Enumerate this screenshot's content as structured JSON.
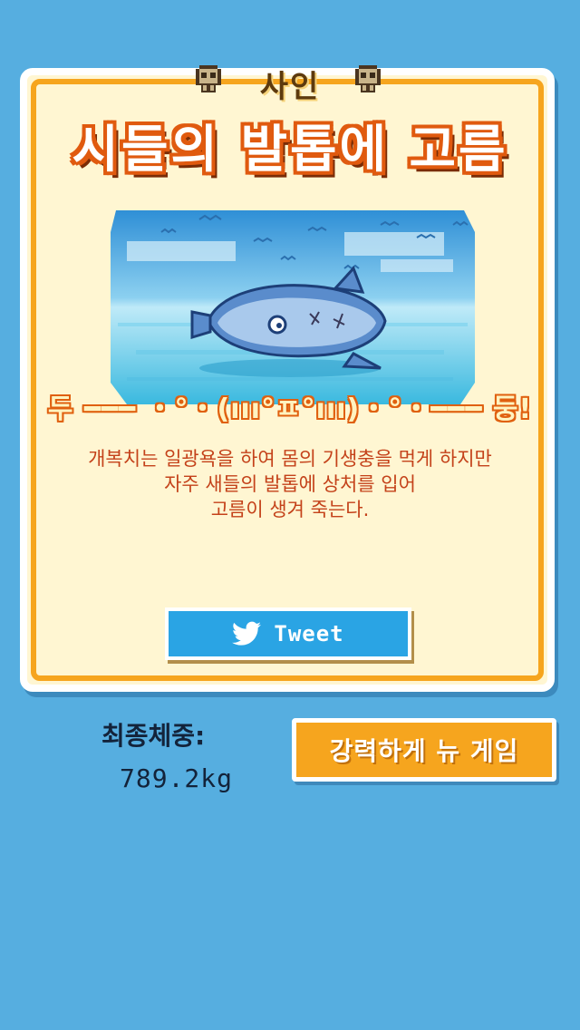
{
  "result": {
    "subtitle": "사인",
    "title": "시들의 발톱에 고름",
    "cry": "두 ━━━ ・°・(ııı°ㅍ°ııı)・°・━━━ 둥!",
    "description": [
      "개복치는 일광욕을 하여 몸의 기생충을 먹게 하지만",
      "자주 새들의 발톱에 상처를 입어",
      "고름이 생겨 죽는다."
    ],
    "tweet_label": "Tweet"
  },
  "final_weight": {
    "label": "최종체중:",
    "value": "789.2kg"
  },
  "new_game_label": "강력하게 뉴 게임",
  "colors": {
    "background": "#56aee0",
    "card": "#fff6d2",
    "accent_orange": "#f6a51e",
    "tweet_blue": "#2aa4e4",
    "text_red": "#c4421a"
  },
  "icons": [
    "skull-icon",
    "twitter-bird-icon",
    "sunfish-illustration",
    "seagull-icon"
  ]
}
